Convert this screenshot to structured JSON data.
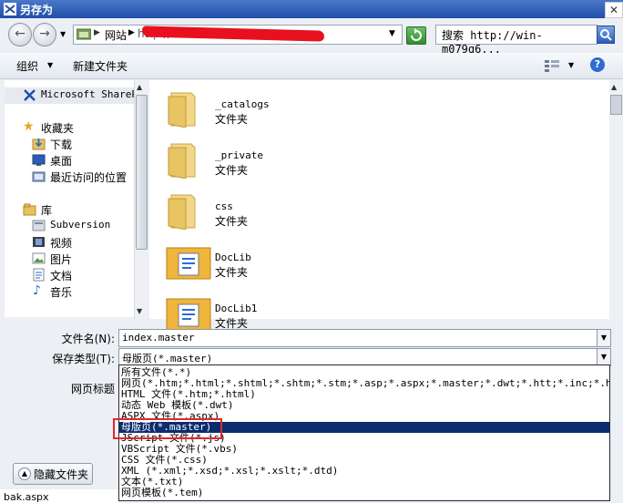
{
  "window": {
    "title": "另存为",
    "close": "✕"
  },
  "nav": {
    "back": "←",
    "forward": "→",
    "address_root": "网站",
    "address_path": "http://win-",
    "refresh_icon": "refresh-icon",
    "search_label": "搜索 http://win-m079q6..."
  },
  "toolbar": {
    "organize": "组织",
    "new_folder": "新建文件夹"
  },
  "sidebar": {
    "items": [
      {
        "label": "Microsoft SharePoint",
        "icon": "sharepoint-icon"
      },
      {
        "label": "收藏夹",
        "icon": "star-icon"
      },
      {
        "label": "下载",
        "icon": "download-folder-icon"
      },
      {
        "label": "桌面",
        "icon": "desktop-icon"
      },
      {
        "label": "最近访问的位置",
        "icon": "recent-places-icon"
      },
      {
        "label": "库",
        "icon": "library-icon"
      },
      {
        "label": "Subversion",
        "icon": "subversion-icon"
      },
      {
        "label": "视频",
        "icon": "video-icon"
      },
      {
        "label": "图片",
        "icon": "pictures-icon"
      },
      {
        "label": "文档",
        "icon": "documents-icon"
      },
      {
        "label": "音乐",
        "icon": "music-icon"
      }
    ]
  },
  "files": [
    {
      "name": "_catalogs",
      "type": "文件夹",
      "icon": "folder-icon"
    },
    {
      "name": "_private",
      "type": "文件夹",
      "icon": "folder-icon"
    },
    {
      "name": "css",
      "type": "文件夹",
      "icon": "folder-icon"
    },
    {
      "name": "DocLib",
      "type": "文件夹",
      "icon": "doclib-folder-icon"
    },
    {
      "name": "DocLib1",
      "type": "文件夹",
      "icon": "doclib-folder-icon"
    }
  ],
  "form": {
    "filename_label": "文件名(N):",
    "filename_value": "index.master",
    "filetype_label": "保存类型(T):",
    "filetype_value": "母版页(*.master)",
    "page_title_label": "网页标题"
  },
  "filetype_options": [
    "所有文件(*.*)",
    "网页(*.htm;*.html;*.shtml;*.shtm;*.stm;*.asp;*.aspx;*.master;*.dwt;*.htt;*.inc;*.hta;*.ht",
    "HTML 文件(*.htm;*.html)",
    "动态 Web 模板(*.dwt)",
    "ASPX 文件(*.aspx)",
    "母版页(*.master)",
    "JScript 文件(*.js)",
    "VBScript 文件(*.vbs)",
    "CSS 文件(*.css)",
    "XML (*.xml;*.xsd;*.xsl;*.xslt;*.dtd)",
    "文本(*.txt)",
    "网页模板(*.tem)"
  ],
  "selected_option_index": 5,
  "hide_folders": "隐藏文件夹",
  "background_filename": "bak.aspx",
  "colors": {
    "titlebar": "#1f4fa8",
    "selection": "#0c2c6e",
    "highlight_box": "#e1282a"
  }
}
